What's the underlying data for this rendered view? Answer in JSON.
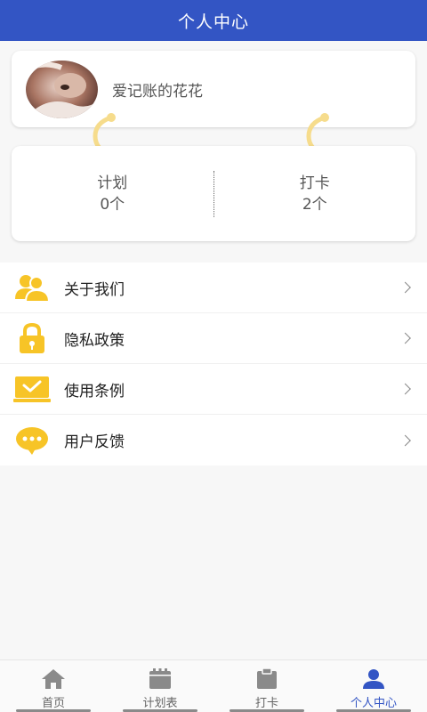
{
  "header": {
    "title": "个人中心"
  },
  "profile": {
    "nickname": "爱记账的花花"
  },
  "stats": [
    {
      "label": "计划",
      "value": "0个"
    },
    {
      "label": "打卡",
      "value": "2个"
    }
  ],
  "menu": [
    {
      "label": "关于我们",
      "icon": "users-icon"
    },
    {
      "label": "隐私政策",
      "icon": "lock-icon"
    },
    {
      "label": "使用条例",
      "icon": "laptop-check-icon"
    },
    {
      "label": "用户反馈",
      "icon": "chat-bubble-icon"
    }
  ],
  "tabs": [
    {
      "label": "首页",
      "icon": "home-icon"
    },
    {
      "label": "计划表",
      "icon": "calendar-icon"
    },
    {
      "label": "打卡",
      "icon": "clipboard-icon"
    },
    {
      "label": "个人中心",
      "icon": "person-icon",
      "active": true
    }
  ],
  "colors": {
    "primary": "#3355c4",
    "accent_yellow": "#f7c427",
    "connector": "#f6dc8c",
    "tab_icon_gray": "#8a8a8a"
  }
}
